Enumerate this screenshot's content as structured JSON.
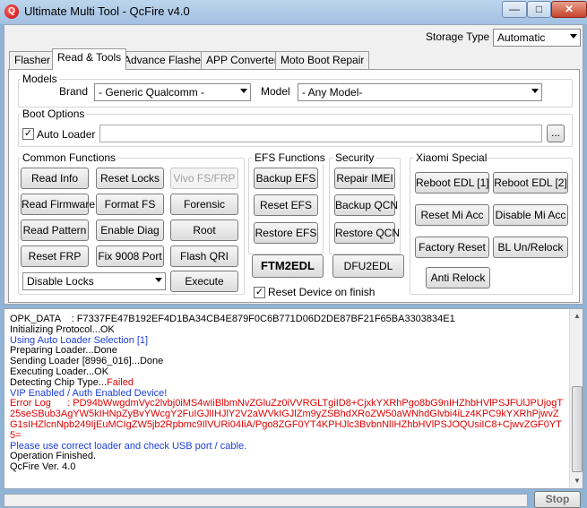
{
  "window": {
    "title": "Ultimate Multi Tool - QcFire v4.0",
    "icon_text": "Q",
    "minimize": "—",
    "maximize": "□",
    "close": "✕"
  },
  "storage": {
    "label": "Storage Type",
    "value": "Automatic"
  },
  "tabs": [
    "Flasher",
    "Read & Tools",
    "Advance Flasher",
    "APP Converter",
    "Moto Boot Repair"
  ],
  "active_tab": "Read & Tools",
  "models": {
    "title": "Models",
    "brand_label": "Brand",
    "brand_value": "- Generic Qualcomm -",
    "model_label": "Model",
    "model_value": "- Any Model-"
  },
  "boot_options": {
    "title": "Boot Options",
    "auto_loader_label": "Auto Loader",
    "auto_loader_checked": true,
    "browse_label": "..."
  },
  "common_functions": {
    "title": "Common Functions",
    "buttons": [
      "Read Info",
      "Reset Locks",
      "Vivo FS/FRP",
      "Read Firmware",
      "Format FS",
      "Forensic",
      "Read Pattern",
      "Enable Diag",
      "Root",
      "Reset FRP",
      "Fix 9008 Port",
      "Flash QRI"
    ],
    "disabled": [
      "Vivo FS/FRP"
    ],
    "mode_value": "Disable Locks",
    "execute_label": "Execute"
  },
  "efs_functions": {
    "title": "EFS Functions",
    "buttons": [
      "Backup EFS",
      "Reset EFS",
      "Restore EFS"
    ]
  },
  "security": {
    "title": "Security",
    "buttons": [
      "Repair IMEI",
      "Backup QCN",
      "Restore QCN"
    ]
  },
  "xiaomi": {
    "title": "Xiaomi Special",
    "buttons": [
      "Reboot EDL [1]",
      "Reboot EDL [2]",
      "Reset Mi Acc",
      "Disable Mi Acc",
      "Factory Reset",
      "BL Un/Relock",
      "Anti Relock"
    ]
  },
  "modes": {
    "ftm": "FTM2EDL",
    "dfu": "DFU2EDL"
  },
  "reset_on_finish": {
    "label": "Reset Device on finish",
    "checked": true
  },
  "log": [
    {
      "text": "OPK_DATA    : F7337FE47B192EF4D1BA34CB4E879F0C6B771D06D2DE87BF21F65BA3303834E1",
      "color": "#000000"
    },
    {
      "text": "Initializing Protocol...OK",
      "color": "#000000"
    },
    {
      "text": "Using Auto Loader Selection [1]",
      "color": "#1c3fd8"
    },
    {
      "text": "Preparing Loader...Done",
      "color": "#000000"
    },
    {
      "text": "Sending Loader [8996_016]...Done",
      "color": "#000000"
    },
    {
      "text": "Executing Loader...OK",
      "color": "#000000"
    },
    {
      "text": "Detecting Chip Type...",
      "color": "#000000",
      "suffix": "Failed",
      "suffix_color": "#e00000"
    },
    {
      "text": "VIP Enabled / Auth Enabled Device!",
      "color": "#1c3fd8"
    },
    {
      "text": "Error Log      : PD94bWwgdmVyc2lvbj0iMS4wIiBlbmNvZGluZz0iVVRGLTgiID8+CjxkYXRhPgo8bG9nIHZhbHVlPSJFUlJPUjogT25seSBub3AgYW5kIHNpZyBvYWcgY2FuIGJlIHJlY2V2aWVkIGJlZm9yZSBhdXRoZW50aWNhdGlvbi4iLz4KPC9kYXRhPjwvZG1sIHZlcnNpb249IjEuMCIgZW5jb2Rpbmc9IlVURi04IiA/Pgo8ZGF0YT4KPHJlc3BvbnNlIHZhbHVlPSJOQUsiIC8+CjwvZGF0YT5=",
      "color": "#e00000"
    },
    {
      "text": "Please use correct loader and check USB port / cable.",
      "color": "#1c3fd8"
    },
    {
      "text": "Operation Finished.",
      "color": "#000000"
    },
    {
      "text": "QcFire Ver. 4.0",
      "color": "#000000"
    }
  ],
  "stop_label": "Stop"
}
